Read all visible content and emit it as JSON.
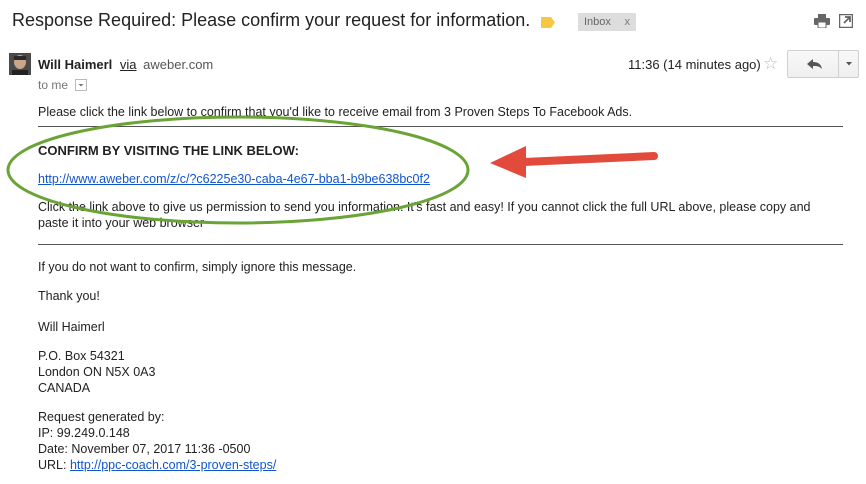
{
  "subject": "Response Required: Please confirm your request for information.",
  "inbox_label": "Inbox",
  "inbox_close": "x",
  "sender": {
    "name": "Will Haimerl",
    "via": "via",
    "domain": "aweber.com",
    "to": "to me"
  },
  "timestamp": "11:36 (14 minutes ago)",
  "icons": {
    "label": "label-tag-icon",
    "print": "print-icon",
    "new_window": "new-window-icon",
    "star": "star-icon",
    "reply": "reply-icon",
    "more": "chevron-down-icon"
  },
  "body": {
    "intro": "Please click the link below to confirm that you'd like to receive email from 3 Proven Steps To Facebook Ads.",
    "confirm_title": "CONFIRM BY VISITING THE LINK BELOW:",
    "confirm_link": "http://www.aweber.com/z/c/?c6225e30-caba-4e67-bba1-b9be638bc0f2",
    "instruction_line1": "Click the link above to give us permission to send you information. It's fast and easy! If you cannot click the full URL above, please copy and",
    "instruction_line2": "paste it into your web browser",
    "ignore": "If you do not want to confirm, simply ignore this message.",
    "thanks": "Thank you!",
    "signature": "Will Haimerl",
    "address": [
      "P.O. Box 54321",
      "London ON N5X 0A3",
      "CANADA"
    ],
    "request_heading": "Request generated by:",
    "ip": "IP: 99.249.0.148",
    "date": "Date: November 07, 2017 11:36 -0500",
    "url_label": "URL: ",
    "url_link": "http://ppc-coach.com/3-proven-steps/"
  },
  "colors": {
    "highlight_ellipse": "#6aa336",
    "arrow": "#e24a3b",
    "link": "#1155cc",
    "label_tag": "#f6c842"
  }
}
